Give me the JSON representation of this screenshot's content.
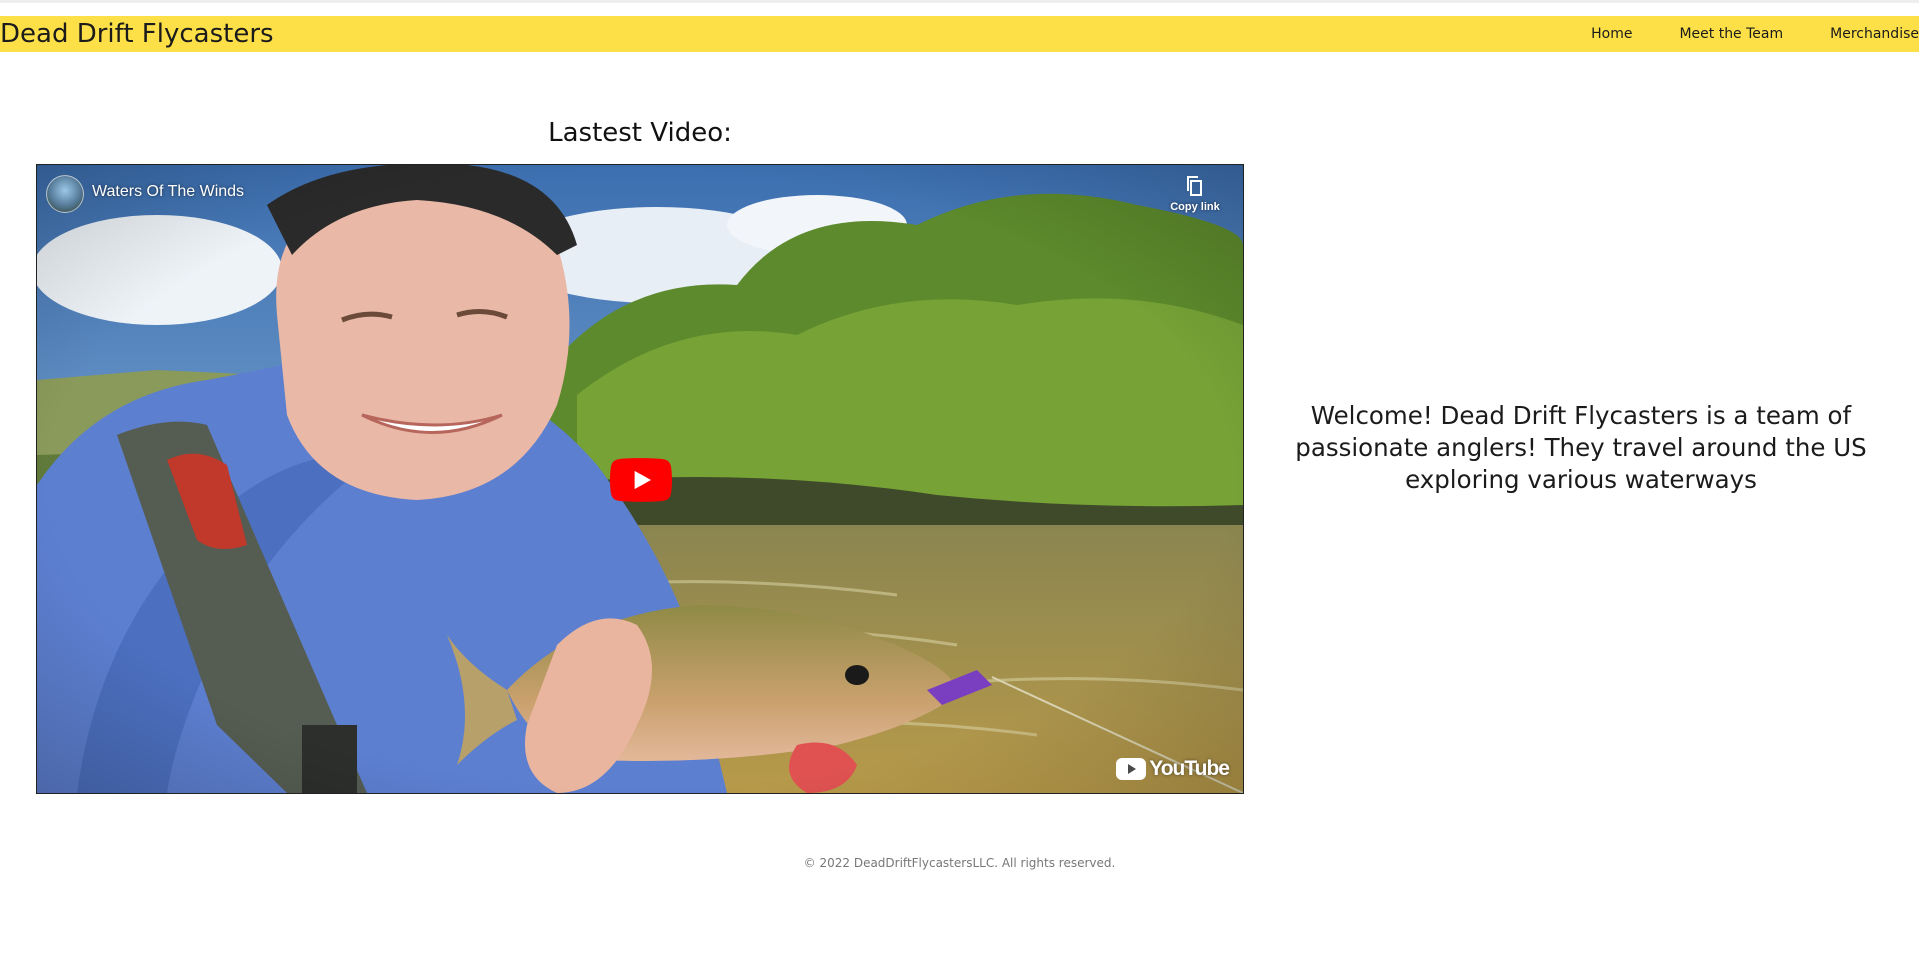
{
  "brand": {
    "name": "Dead Drift Flycasters"
  },
  "nav": {
    "items": [
      {
        "label": "Home"
      },
      {
        "label": "Meet the Team"
      },
      {
        "label": "Merchandise"
      }
    ]
  },
  "main": {
    "video_heading": "Lastest Video:",
    "video": {
      "title": "Waters Of The Winds",
      "copy_link_label": "Copy link",
      "brand_label": "YouTube"
    },
    "welcome_text": "Welcome! Dead Drift Flycasters is a team of passionate anglers! They travel around the US exploring various waterways"
  },
  "footer": {
    "copyright": "© 2022 DeadDriftFlycastersLLC. All rights reserved."
  },
  "colors": {
    "navbar_background": "#fde047",
    "youtube_red": "#ff0000",
    "text": "#1b1b1b",
    "footer_text": "#777777"
  },
  "icons": [
    "copy-link-icon",
    "play-icon",
    "youtube-logo-icon"
  ]
}
